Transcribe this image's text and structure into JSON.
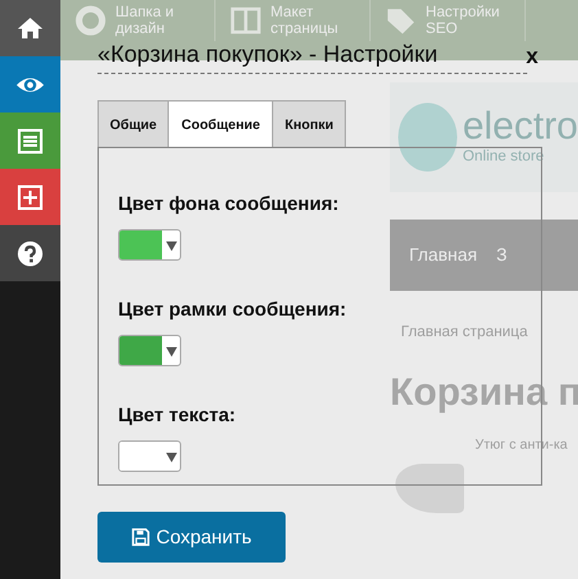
{
  "sidebar": {
    "items": [
      {
        "color": "#555555",
        "selected": false
      },
      {
        "color": "#0a78b4",
        "selected": true
      },
      {
        "color": "#4a9a3c",
        "selected": false
      },
      {
        "color": "#d9403f",
        "selected": false
      },
      {
        "color": "#444444",
        "selected": false
      }
    ]
  },
  "background_page": {
    "toolbar": [
      {
        "label": "Шапка и дизайн"
      },
      {
        "label": "Макет страницы"
      },
      {
        "label": "Настройки SEO"
      }
    ],
    "logo": {
      "name": "electro",
      "tagline": "Online store"
    },
    "nav": [
      {
        "label": "Главная"
      },
      {
        "label": "З"
      }
    ],
    "breadcrumb": "Главная страница",
    "heading": "Корзина п",
    "product": "Утюг с анти-ка"
  },
  "dialog": {
    "title": "«Корзина покупок» - Настройки",
    "close": "x",
    "tabs": [
      {
        "label": "Общие",
        "selected": false
      },
      {
        "label": "Сообщение",
        "selected": true
      },
      {
        "label": "Кнопки",
        "selected": false
      }
    ],
    "fields": [
      {
        "label": "Цвет фона сообщения:",
        "color": "#4cc355"
      },
      {
        "label": "Цвет рамки сообщения:",
        "color": "#3fa847"
      },
      {
        "label": "Цвет текста:",
        "color": "#ffffff"
      }
    ],
    "save_button": "Сохранить"
  }
}
